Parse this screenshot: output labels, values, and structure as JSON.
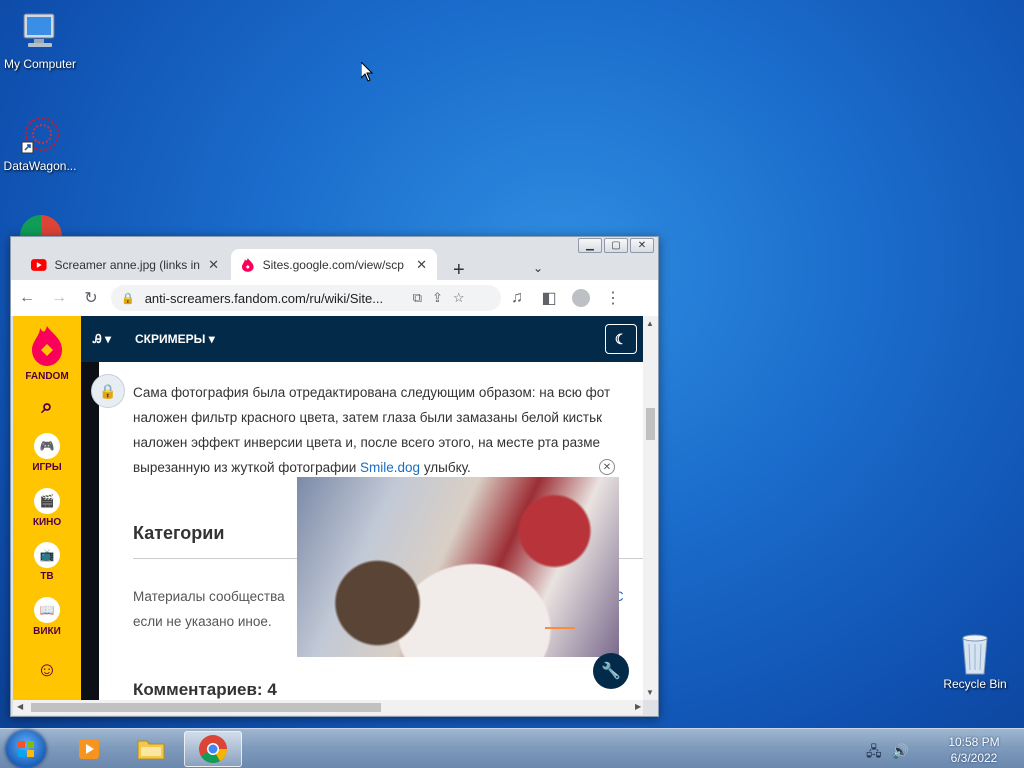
{
  "desktop": {
    "icons": [
      {
        "label": "My Computer",
        "icon": "computer-icon"
      },
      {
        "label": "DataWagon...",
        "icon": "datawagon-icon"
      },
      {
        "label": "Recycle Bin",
        "icon": "recycle-bin-icon"
      }
    ]
  },
  "browser": {
    "tabs": [
      {
        "title": "Screamer anne.jpg (links in",
        "icon": "youtube-icon"
      },
      {
        "title": "Sites.google.com/view/scp",
        "icon": "fandom-icon"
      }
    ],
    "url": "anti-screamers.fandom.com/ru/wiki/Site..."
  },
  "page": {
    "brand": "FANDOM",
    "rail_items": [
      {
        "label": "ИГРЫ",
        "icon": "gamepad-icon"
      },
      {
        "label": "КИНО",
        "icon": "film-icon"
      },
      {
        "label": "ТВ",
        "icon": "tv-icon"
      },
      {
        "label": "ВИКИ",
        "icon": "book-icon"
      }
    ],
    "header_tool": "",
    "header_nav": "СКРИМЕРЫ",
    "article_lines": [
      "Сама фотография была отредактирована следующим образом: на всю фот",
      "наложен фильтр красного цвета, затем глаза были замазаны белой кистьк",
      "наложен эффект инверсии цвета и, после всего этого, на месте рта разме"
    ],
    "article_last_pre": "вырезанную из жуткой фотографии ",
    "article_link": "Smile.dog",
    "article_last_post": " улыбку.",
    "categories_title": "Категории",
    "cc_line1": "Материалы сообщества",
    "cc_line1_tail": "и С",
    "cc_line2": "если не указано иное.",
    "comments": "Комментариев: 4"
  },
  "taskbar": {
    "time": "10:58 PM",
    "date": "6/3/2022"
  },
  "colors": {
    "fandom_yellow": "#ffc500",
    "fandom_navy": "#042a4a",
    "link_blue": "#1a6ec2"
  }
}
